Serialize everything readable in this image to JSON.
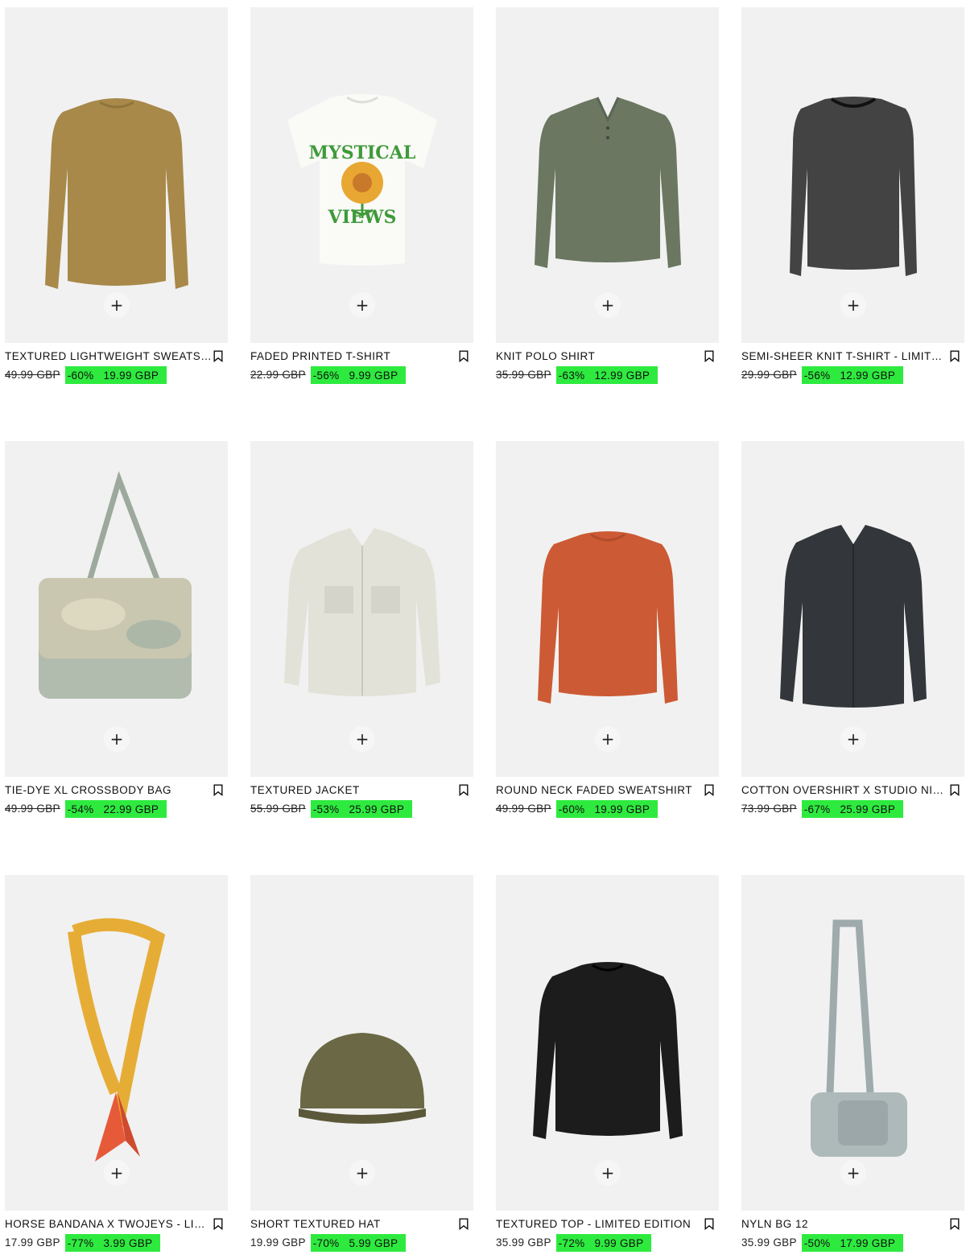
{
  "colors": {
    "sale_bg": "#2eea3f",
    "card_bg": "#f1f1f1"
  },
  "add_label": "+",
  "products": [
    {
      "name": "TEXTURED LIGHTWEIGHT SWEATSHIRT",
      "old_price": "49.99 GBP",
      "discount": "-60%",
      "price": "19.99 GBP",
      "struck": true,
      "image": "mustard-sweater"
    },
    {
      "name": "FADED PRINTED T-SHIRT",
      "old_price": "22.99 GBP",
      "discount": "-56%",
      "price": "9.99 GBP",
      "struck": true,
      "image": "printed-tshirt"
    },
    {
      "name": "KNIT POLO SHIRT",
      "old_price": "35.99 GBP",
      "discount": "-63%",
      "price": "12.99 GBP",
      "struck": true,
      "image": "green-polo"
    },
    {
      "name": "SEMI-SHEER KNIT T-SHIRT - LIMITED EDITION",
      "old_price": "29.99 GBP",
      "discount": "-56%",
      "price": "12.99 GBP",
      "struck": true,
      "image": "sheer-top"
    },
    {
      "name": "TIE-DYE XL CROSSBODY BAG",
      "old_price": "49.99 GBP",
      "discount": "-54%",
      "price": "22.99 GBP",
      "struck": true,
      "image": "tiedye-bag"
    },
    {
      "name": "TEXTURED JACKET",
      "old_price": "55.99 GBP",
      "discount": "-53%",
      "price": "25.99 GBP",
      "struck": true,
      "image": "cream-jacket"
    },
    {
      "name": "ROUND NECK FADED SWEATSHIRT",
      "old_price": "49.99 GBP",
      "discount": "-60%",
      "price": "19.99 GBP",
      "struck": true,
      "image": "orange-sweatshirt"
    },
    {
      "name": "COTTON OVERSHIRT X STUDIO NICHOLSON",
      "old_price": "73.99 GBP",
      "discount": "-67%",
      "price": "25.99 GBP",
      "struck": true,
      "image": "dark-overshirt"
    },
    {
      "name": "HORSE BANDANA X TWOJEYS - LIMITED EDITION",
      "old_price": "17.99 GBP",
      "discount": "-77%",
      "price": "3.99 GBP",
      "struck": false,
      "image": "bandana"
    },
    {
      "name": "SHORT TEXTURED HAT",
      "old_price": "19.99 GBP",
      "discount": "-70%",
      "price": "5.99 GBP",
      "struck": false,
      "image": "olive-hat"
    },
    {
      "name": "TEXTURED TOP - LIMITED EDITION",
      "old_price": "35.99 GBP",
      "discount": "-72%",
      "price": "9.99 GBP",
      "struck": false,
      "image": "black-knit-top"
    },
    {
      "name": "NYLN BG 12",
      "old_price": "35.99 GBP",
      "discount": "-50%",
      "price": "17.99 GBP",
      "struck": false,
      "image": "grey-crossbody"
    }
  ]
}
